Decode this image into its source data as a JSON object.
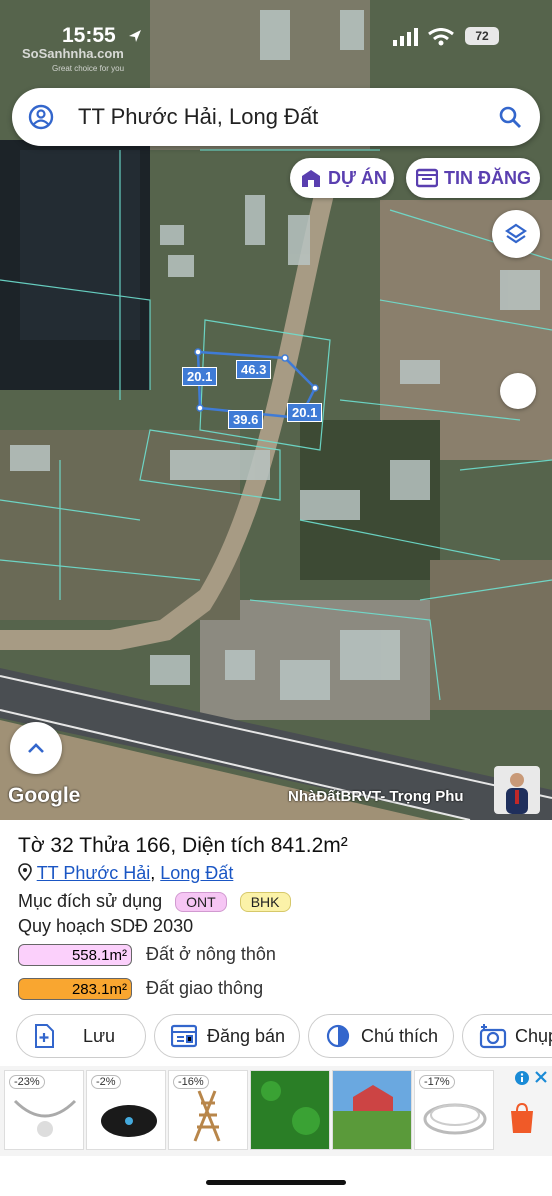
{
  "status": {
    "time": "15:55",
    "battery": "72",
    "watermark": "SoSanhnha.com",
    "watermark_sub": "Great choice for you"
  },
  "search": {
    "query": "TT Phước Hải, Long Đất"
  },
  "chips": {
    "du_an": "DỰ ÁN",
    "tin_dang": "TIN ĐĂNG"
  },
  "map": {
    "dimensions": [
      "20.1",
      "46.3",
      "20.1",
      "39.6"
    ],
    "google_logo": "Google",
    "attribution": "NhàĐấtBRVT- Trọng Phu"
  },
  "parcel": {
    "title": "Tờ 32 Thửa 166, Diện tích 841.2m²",
    "location_ward": "TT Phước Hải",
    "location_separator": ",",
    "location_district": "Long Đất",
    "purpose_label": "Mục đích sử dụng",
    "purpose_codes": [
      {
        "code": "ONT",
        "color": "#f6c6f4"
      },
      {
        "code": "BHK",
        "color": "#fbf2a8"
      }
    ],
    "plan_label": "Quy hoạch SDĐ 2030",
    "areas": [
      {
        "value": "558.1m²",
        "label": "Đất ở nông thôn",
        "color": "#fbd0fb"
      },
      {
        "value": "283.1m²",
        "label": "Đất giao thông",
        "color": "#f9a630"
      }
    ]
  },
  "actions": {
    "save": "Lưu",
    "sell": "Đăng bán",
    "legend": "Chú thích",
    "capture": "Chụp"
  },
  "ads": [
    {
      "discount": "-23%"
    },
    {
      "discount": "-2%"
    },
    {
      "discount": "-16%"
    },
    {
      "discount": ""
    },
    {
      "discount": ""
    },
    {
      "discount": "-17%"
    }
  ],
  "colors": {
    "accent": "#5a3fb0",
    "link": "#1a56c4",
    "parcel_line": "#3f7bd6",
    "cadastral": "#6ee0d0"
  }
}
